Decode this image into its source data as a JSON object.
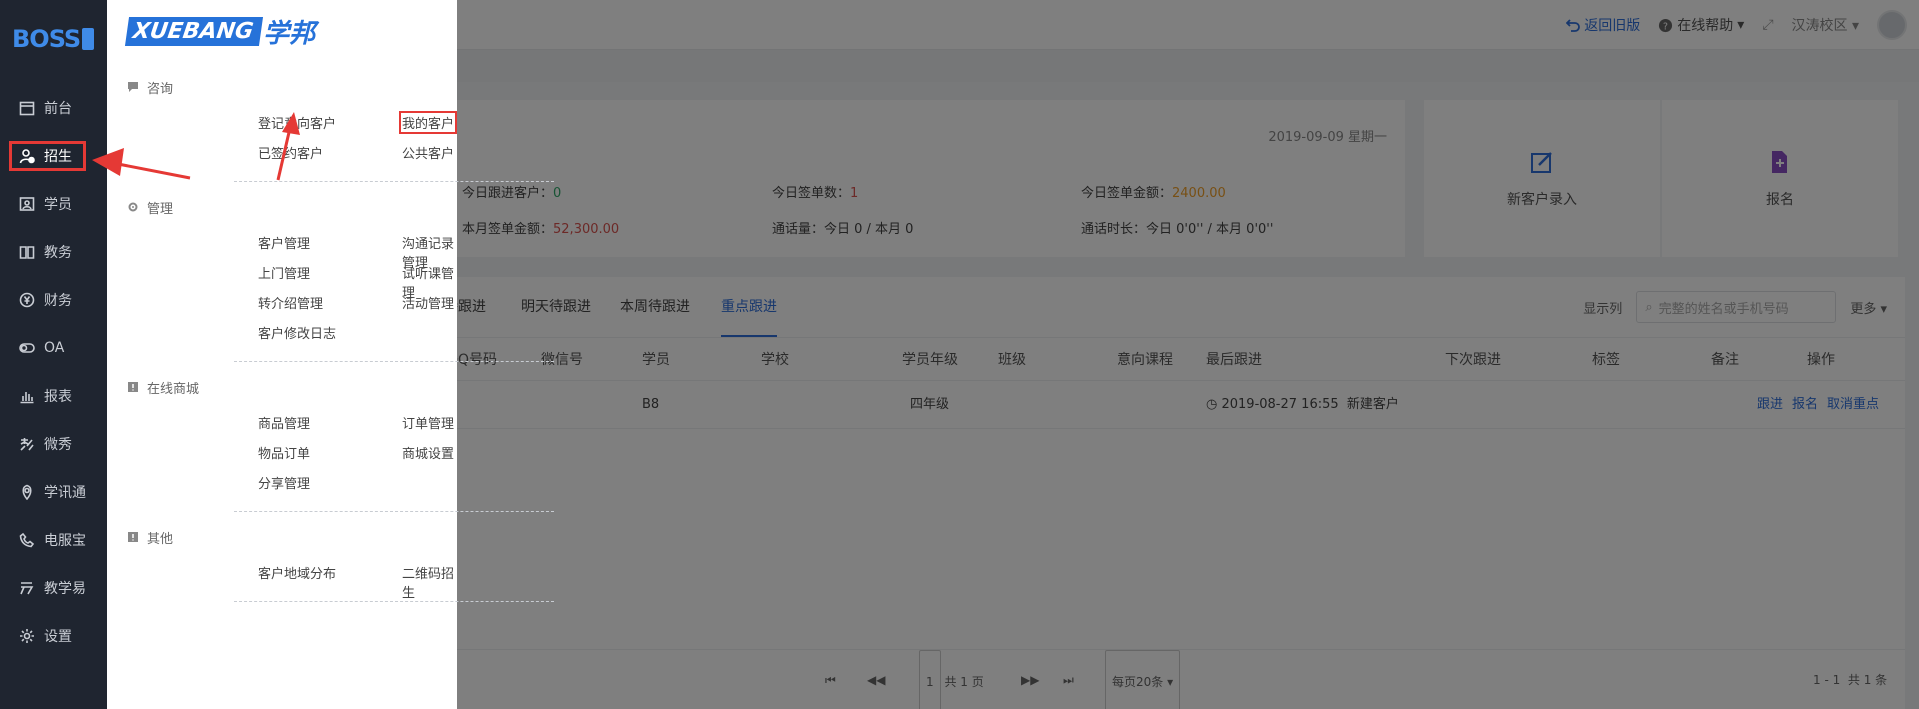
{
  "sidebar": {
    "logo": "BOSS",
    "items": [
      {
        "label": "前台",
        "icon": "calendar-icon"
      },
      {
        "label": "招生",
        "icon": "user-add-icon"
      },
      {
        "label": "学员",
        "icon": "id-card-icon"
      },
      {
        "label": "教务",
        "icon": "book-icon"
      },
      {
        "label": "财务",
        "icon": "yen-icon"
      },
      {
        "label": "OA",
        "icon": "toggle-icon"
      },
      {
        "label": "报表",
        "icon": "bar-chart-icon"
      },
      {
        "label": "微秀",
        "icon": "wechat-show-icon"
      },
      {
        "label": "学讯通",
        "icon": "location-icon"
      },
      {
        "label": "电服宝",
        "icon": "phone-icon"
      },
      {
        "label": "教学易",
        "icon": "teach-icon"
      },
      {
        "label": "设置",
        "icon": "gear-icon"
      }
    ],
    "active_index": 1
  },
  "flyout": {
    "brand_en": "XUEBANG",
    "brand_cn": "学邦",
    "sections": [
      {
        "title": "咨询",
        "icon": "chat-icon",
        "items": [
          "登记意向客户",
          "我的客户",
          "已签约客户",
          "公共客户"
        ]
      },
      {
        "title": "管理",
        "icon": "gear-icon",
        "items": [
          "客户管理",
          "沟通记录管理",
          "上门管理",
          "试听课管理",
          "转介绍管理",
          "活动管理",
          "客户修改日志"
        ]
      },
      {
        "title": "在线商城",
        "icon": "store-icon",
        "items": [
          "商品管理",
          "订单管理",
          "物品订单",
          "商城设置",
          "分享管理"
        ]
      },
      {
        "title": "其他",
        "icon": "other-icon",
        "items": [
          "客户地域分布",
          "二维码招生"
        ]
      }
    ]
  },
  "topbar": {
    "back_label": "返回旧版",
    "help_label": "在线帮助",
    "campus_label": "汉涛校区"
  },
  "stats": {
    "date": "2019-09-09 星期一",
    "today_follow_label": "今日跟进客户：",
    "today_follow_value": "0",
    "today_sign_count_label": "今日签单数：",
    "today_sign_count_value": "1",
    "today_sign_amount_label": "今日签单金额：",
    "today_sign_amount_value": "2400.00",
    "month_sign_amount_label": "本月签单金额：",
    "month_sign_amount_value": "52,300.00",
    "call_count": "通话量：今日 0 / 本月 0",
    "call_duration": "通话时长：今日 0'0'' / 本月 0'0''"
  },
  "quick": {
    "new_customer": "新客户录入",
    "enroll": "报名"
  },
  "list": {
    "tabs": [
      "待跟进",
      "明天待跟进",
      "本周待跟进",
      "重点跟进"
    ],
    "active_tab": 3,
    "show_columns": "显示列",
    "search_placeholder": "完整的姓名或手机号码",
    "more": "更多",
    "headers": [
      "QQ号码",
      "微信号",
      "学员",
      "学校",
      "学员年级",
      "班级",
      "意向课程",
      "最后跟进",
      "下次跟进",
      "标签",
      "备注",
      "操作"
    ],
    "row": {
      "student": "B8",
      "grade": "四年级",
      "last_follow": "2019-08-27 16:55",
      "last_follow_note": "新建客户",
      "actions": [
        "跟进",
        "报名",
        "取消重点"
      ]
    },
    "pager": {
      "page": "1",
      "total_pages": "共 1 页",
      "page_size": "每页20条",
      "range": "1 - 1",
      "total": "共 1 条"
    }
  }
}
